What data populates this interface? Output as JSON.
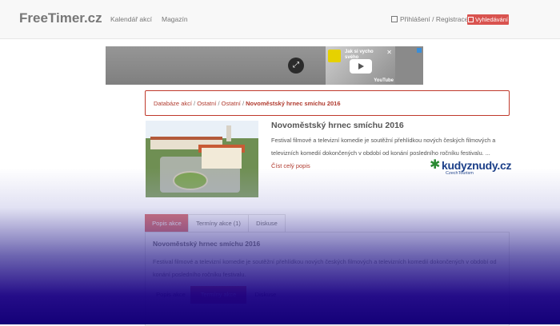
{
  "header": {
    "brand": "FreeTimer.cz",
    "nav": [
      "Kalendář akcí",
      "Magazín"
    ],
    "login": "Přihlášení / Registrace",
    "search_button": "Vyhledávání"
  },
  "ad": {
    "video_title_line1": "Jak si vycho",
    "video_title_line2": "svého",
    "video_source": "YouTube",
    "close_symbol": "✕"
  },
  "breadcrumb": {
    "items": [
      "Databáze akcí",
      "Ostatní",
      "Ostatní"
    ],
    "separator": " / ",
    "current": "Novoměstský hrnec smíchu 2016"
  },
  "event": {
    "title": "Novoměstský hrnec smíchu 2016",
    "description": "Festival filmové a televizní komedie je soutěžní přehlídkou nových českých filmových a televizních komedií dokončených v období od konání posledního ročníku festivalu. ...",
    "read_more": "Číst celý popis",
    "partner_logo": "kudyznudy.cz",
    "partner_sub": "CzechTourism"
  },
  "tabs": [
    {
      "label": "Popis akce",
      "active": true
    },
    {
      "label": "Termíny akce (1)",
      "active": false
    },
    {
      "label": "Diskuse",
      "active": false
    }
  ],
  "panel": {
    "title": "Novoměstský hrnec smíchu 2016",
    "text": "Festival filmové a televizní komedie je soutěžní přehlídkou nových českých filmových a televizních komedií dokončených v období od konání posledního ročníku festivalu.",
    "subtabs": [
      {
        "label": "Popis akce",
        "active": false
      },
      {
        "label": "Termíny akce",
        "active": true
      },
      {
        "label": "Diskuse",
        "active": false
      }
    ]
  },
  "colors": {
    "accent": "#d9534f",
    "link": "#b03a2e",
    "overlay": "#140078"
  }
}
